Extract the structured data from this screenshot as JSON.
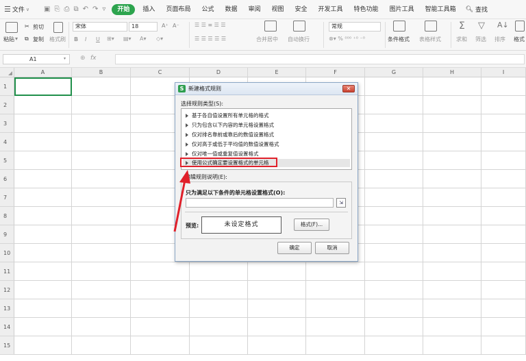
{
  "menubar": {
    "file_label": "文件",
    "tabs": [
      "开始",
      "插入",
      "页面布局",
      "公式",
      "数据",
      "审阅",
      "视图",
      "安全",
      "开发工具",
      "特色功能",
      "图片工具",
      "智能工具箱"
    ],
    "active_tab": "开始",
    "search_label": "查找"
  },
  "ribbon": {
    "paste": "粘贴",
    "cut": "剪切",
    "copy": "复制",
    "format_painter": "格式刷",
    "font_name": "宋体",
    "font_size": "18",
    "number_format": "常规",
    "merge_center": "合并居中",
    "wrap_text": "自动换行",
    "conditional_format": "条件格式",
    "table_style": "表格样式",
    "sum": "求和",
    "filter": "筛选",
    "sort": "排序",
    "format": "格式"
  },
  "formula_bar": {
    "cell_ref": "A1",
    "fx": "fx",
    "value": ""
  },
  "sheet": {
    "columns": [
      "A",
      "B",
      "C",
      "D",
      "E",
      "F",
      "G",
      "H",
      "I"
    ],
    "rows": [
      "1",
      "2",
      "3",
      "4",
      "5",
      "6",
      "7",
      "8",
      "9",
      "10",
      "11",
      "12",
      "13",
      "14",
      "15"
    ],
    "selected_cell": "A1"
  },
  "dialog": {
    "title": "新建格式规则",
    "rule_type_label": "选择规则类型(S):",
    "rule_types": [
      "基于各自值设置所有单元格的格式",
      "只为包含以下内容的单元格设置格式",
      "仅对排名靠前或靠后的数值设置格式",
      "仅对高于或低于平均值的数值设置格式",
      "仅对唯一值或重复值设置格式",
      "使用公式确定要设置格式的单元格"
    ],
    "selected_rule_index": 5,
    "edit_desc_label": "编辑规则说明(E):",
    "formula_label": "只为满足以下条件的单元格设置格式(O):",
    "formula_value": "",
    "preview_label": "预览:",
    "preview_text": "未设定格式",
    "format_button": "格式(F)...",
    "ok_button": "确定",
    "cancel_button": "取消"
  },
  "annotation": {
    "highlight_color": "#e0202a"
  }
}
